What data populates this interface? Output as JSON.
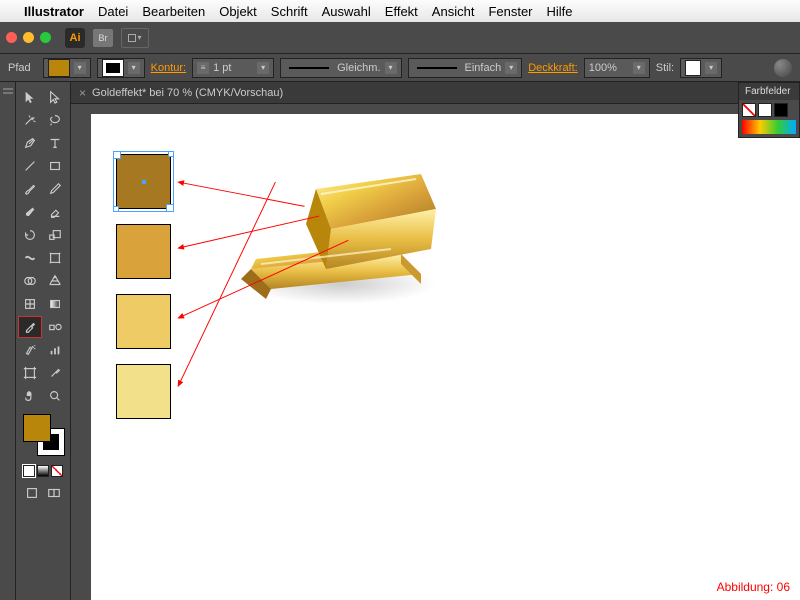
{
  "menubar": {
    "app": "Illustrator",
    "items": [
      "Datei",
      "Bearbeiten",
      "Objekt",
      "Schrift",
      "Auswahl",
      "Effekt",
      "Ansicht",
      "Fenster",
      "Hilfe"
    ]
  },
  "appbar": {
    "badge": "Ai",
    "bridge": "Br"
  },
  "controlbar": {
    "label": "Pfad",
    "stroke_label": "Kontur:",
    "stroke_weight": "1 pt",
    "dash_label": "Gleichm.",
    "profile_label": "Einfach",
    "opacity_label": "Deckkraft:",
    "opacity_value": "100%",
    "style_label": "Stil:",
    "fill_color": "#b8860b"
  },
  "document": {
    "tab_title": "Goldeffekt* bei 70 % (CMYK/Vorschau)",
    "figure_caption": "Abbildung: 06"
  },
  "swatches": {
    "panel_title": "Farbfelder",
    "gold": [
      {
        "color": "#a67821",
        "selected": true
      },
      {
        "color": "#d9a23a",
        "selected": false
      },
      {
        "color": "#eecb65",
        "selected": false
      },
      {
        "color": "#f3e08a",
        "selected": false
      }
    ]
  },
  "tools": {
    "fill": "#b8860b"
  }
}
